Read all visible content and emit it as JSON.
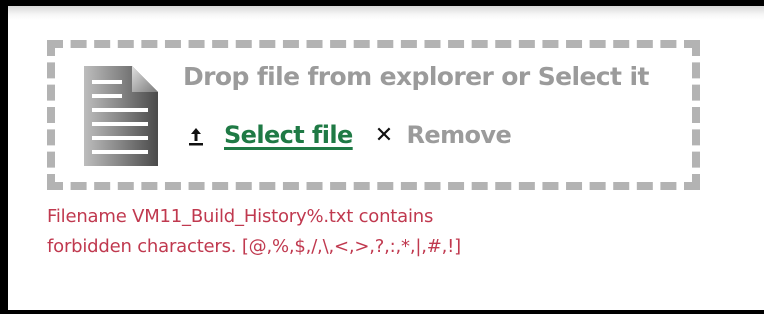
{
  "dropzone": {
    "headline": "Drop file from explorer or Select it",
    "file_icon": "document-icon",
    "upload_icon": "upload-icon",
    "select_label": "Select file",
    "remove_icon": "close-icon",
    "remove_label": "Remove"
  },
  "error": {
    "line1": "Filename VM11_Build_History%.txt contains",
    "line2": "forbidden characters. [@,%,$,/,\\,<,>,?,:,*,|,#,!]"
  },
  "colors": {
    "link": "#1f7a45",
    "muted_text": "#9b9b9b",
    "error": "#c0394f",
    "dashed_border": "#b3b3b3"
  }
}
